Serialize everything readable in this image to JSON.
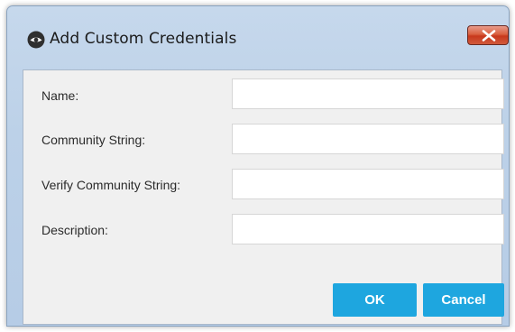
{
  "dialog": {
    "title": "Add Custom Credentials",
    "title_icon": "eye-icon",
    "close_icon": "close-icon"
  },
  "form": {
    "fields": [
      {
        "label": "Name:",
        "value": ""
      },
      {
        "label": "Community String:",
        "value": ""
      },
      {
        "label": "Verify Community String:",
        "value": ""
      },
      {
        "label": "Description:",
        "value": ""
      }
    ]
  },
  "buttons": {
    "ok_label": "OK",
    "cancel_label": "Cancel"
  },
  "colors": {
    "primary_button": "#1ea6df",
    "close_button": "#c8381c",
    "titlebar": "#bcd1e8"
  }
}
